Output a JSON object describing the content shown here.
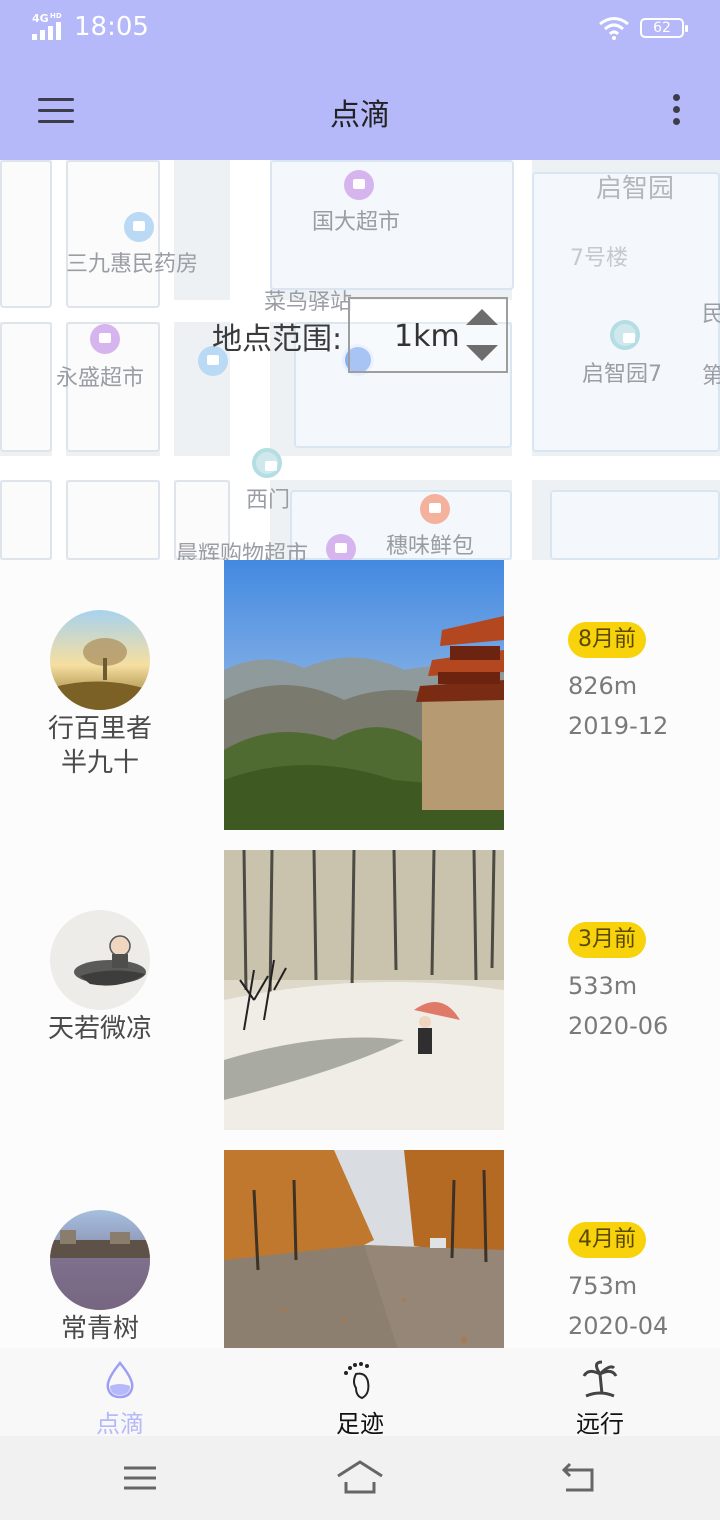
{
  "status_bar": {
    "network": "4G",
    "network_hd": "HD",
    "time": "18:05",
    "battery": "62"
  },
  "header": {
    "title": "点滴",
    "menu_icon": "hamburger-menu-icon",
    "more_icon": "more-vertical-icon"
  },
  "map": {
    "range_label": "地点范围:",
    "range_value": "1km",
    "pois": [
      {
        "label": "国大超市",
        "icon": "supermarket-icon"
      },
      {
        "label": "启智园",
        "icon": ""
      },
      {
        "label": "三九惠民药房",
        "icon": "pharmacy-icon"
      },
      {
        "label": "7号楼",
        "icon": ""
      },
      {
        "label": "菜鸟驿站",
        "icon": ""
      },
      {
        "label": "永盛超市",
        "icon": "supermarket-icon"
      },
      {
        "label": "启智园7",
        "icon": "building-icon"
      },
      {
        "label": "民",
        "icon": ""
      },
      {
        "label": "第",
        "icon": ""
      },
      {
        "label": "西门",
        "icon": "gate-icon"
      },
      {
        "label": "晨辉购物超市",
        "icon": "supermarket-icon"
      },
      {
        "label": "穗味鲜包",
        "icon": "restaurant-icon"
      }
    ]
  },
  "feed": {
    "items": [
      {
        "author_line1": "行百里者",
        "author_line2": "半九十",
        "time_badge": "8月前",
        "distance": "826m",
        "date": "2019-12",
        "photo": "mountain-pavilion-photo",
        "avatar": "misty-tree-avatar"
      },
      {
        "author_line1": "天若微凉",
        "author_line2": "",
        "time_badge": "3月前",
        "distance": "533m",
        "date": "2020-06",
        "photo": "snowy-ink-painting-photo",
        "avatar": "ink-monk-avatar"
      },
      {
        "author_line1": "常青树",
        "author_line2": "",
        "time_badge": "4月前",
        "distance": "753m",
        "date": "2020-04",
        "photo": "autumn-road-photo",
        "avatar": "lake-town-avatar"
      }
    ]
  },
  "bottom_nav": {
    "items": [
      {
        "label": "点滴",
        "icon": "water-drop-icon",
        "active": true
      },
      {
        "label": "足迹",
        "icon": "footprint-icon",
        "active": false
      },
      {
        "label": "远行",
        "icon": "palm-tree-icon",
        "active": false
      }
    ]
  },
  "colors": {
    "accent": "#b5b8f9",
    "badge": "#f8d20a"
  }
}
